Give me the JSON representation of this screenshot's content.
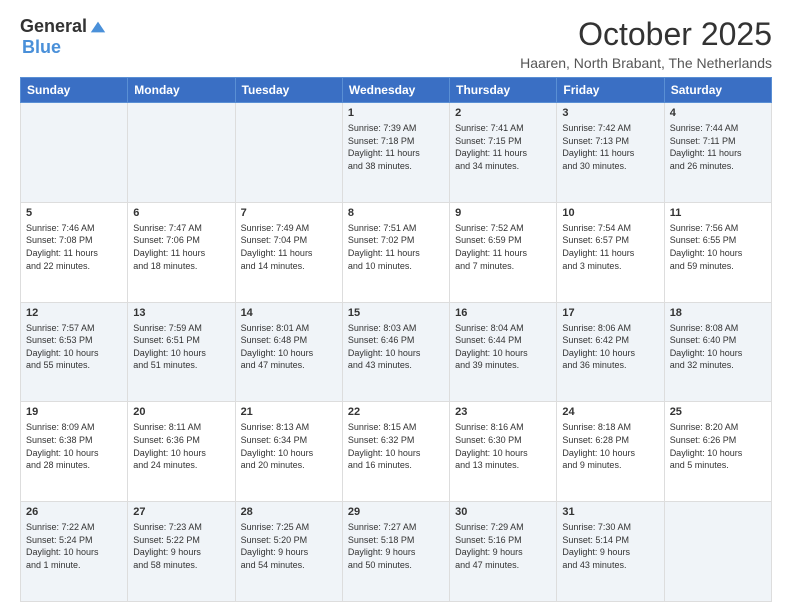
{
  "logo": {
    "general": "General",
    "blue": "Blue"
  },
  "header": {
    "month": "October 2025",
    "location": "Haaren, North Brabant, The Netherlands"
  },
  "days": [
    "Sunday",
    "Monday",
    "Tuesday",
    "Wednesday",
    "Thursday",
    "Friday",
    "Saturday"
  ],
  "weeks": [
    [
      {
        "date": "",
        "info": ""
      },
      {
        "date": "",
        "info": ""
      },
      {
        "date": "",
        "info": ""
      },
      {
        "date": "1",
        "info": "Sunrise: 7:39 AM\nSunset: 7:18 PM\nDaylight: 11 hours\nand 38 minutes."
      },
      {
        "date": "2",
        "info": "Sunrise: 7:41 AM\nSunset: 7:15 PM\nDaylight: 11 hours\nand 34 minutes."
      },
      {
        "date": "3",
        "info": "Sunrise: 7:42 AM\nSunset: 7:13 PM\nDaylight: 11 hours\nand 30 minutes."
      },
      {
        "date": "4",
        "info": "Sunrise: 7:44 AM\nSunset: 7:11 PM\nDaylight: 11 hours\nand 26 minutes."
      }
    ],
    [
      {
        "date": "5",
        "info": "Sunrise: 7:46 AM\nSunset: 7:08 PM\nDaylight: 11 hours\nand 22 minutes."
      },
      {
        "date": "6",
        "info": "Sunrise: 7:47 AM\nSunset: 7:06 PM\nDaylight: 11 hours\nand 18 minutes."
      },
      {
        "date": "7",
        "info": "Sunrise: 7:49 AM\nSunset: 7:04 PM\nDaylight: 11 hours\nand 14 minutes."
      },
      {
        "date": "8",
        "info": "Sunrise: 7:51 AM\nSunset: 7:02 PM\nDaylight: 11 hours\nand 10 minutes."
      },
      {
        "date": "9",
        "info": "Sunrise: 7:52 AM\nSunset: 6:59 PM\nDaylight: 11 hours\nand 7 minutes."
      },
      {
        "date": "10",
        "info": "Sunrise: 7:54 AM\nSunset: 6:57 PM\nDaylight: 11 hours\nand 3 minutes."
      },
      {
        "date": "11",
        "info": "Sunrise: 7:56 AM\nSunset: 6:55 PM\nDaylight: 10 hours\nand 59 minutes."
      }
    ],
    [
      {
        "date": "12",
        "info": "Sunrise: 7:57 AM\nSunset: 6:53 PM\nDaylight: 10 hours\nand 55 minutes."
      },
      {
        "date": "13",
        "info": "Sunrise: 7:59 AM\nSunset: 6:51 PM\nDaylight: 10 hours\nand 51 minutes."
      },
      {
        "date": "14",
        "info": "Sunrise: 8:01 AM\nSunset: 6:48 PM\nDaylight: 10 hours\nand 47 minutes."
      },
      {
        "date": "15",
        "info": "Sunrise: 8:03 AM\nSunset: 6:46 PM\nDaylight: 10 hours\nand 43 minutes."
      },
      {
        "date": "16",
        "info": "Sunrise: 8:04 AM\nSunset: 6:44 PM\nDaylight: 10 hours\nand 39 minutes."
      },
      {
        "date": "17",
        "info": "Sunrise: 8:06 AM\nSunset: 6:42 PM\nDaylight: 10 hours\nand 36 minutes."
      },
      {
        "date": "18",
        "info": "Sunrise: 8:08 AM\nSunset: 6:40 PM\nDaylight: 10 hours\nand 32 minutes."
      }
    ],
    [
      {
        "date": "19",
        "info": "Sunrise: 8:09 AM\nSunset: 6:38 PM\nDaylight: 10 hours\nand 28 minutes."
      },
      {
        "date": "20",
        "info": "Sunrise: 8:11 AM\nSunset: 6:36 PM\nDaylight: 10 hours\nand 24 minutes."
      },
      {
        "date": "21",
        "info": "Sunrise: 8:13 AM\nSunset: 6:34 PM\nDaylight: 10 hours\nand 20 minutes."
      },
      {
        "date": "22",
        "info": "Sunrise: 8:15 AM\nSunset: 6:32 PM\nDaylight: 10 hours\nand 16 minutes."
      },
      {
        "date": "23",
        "info": "Sunrise: 8:16 AM\nSunset: 6:30 PM\nDaylight: 10 hours\nand 13 minutes."
      },
      {
        "date": "24",
        "info": "Sunrise: 8:18 AM\nSunset: 6:28 PM\nDaylight: 10 hours\nand 9 minutes."
      },
      {
        "date": "25",
        "info": "Sunrise: 8:20 AM\nSunset: 6:26 PM\nDaylight: 10 hours\nand 5 minutes."
      }
    ],
    [
      {
        "date": "26",
        "info": "Sunrise: 7:22 AM\nSunset: 5:24 PM\nDaylight: 10 hours\nand 1 minute."
      },
      {
        "date": "27",
        "info": "Sunrise: 7:23 AM\nSunset: 5:22 PM\nDaylight: 9 hours\nand 58 minutes."
      },
      {
        "date": "28",
        "info": "Sunrise: 7:25 AM\nSunset: 5:20 PM\nDaylight: 9 hours\nand 54 minutes."
      },
      {
        "date": "29",
        "info": "Sunrise: 7:27 AM\nSunset: 5:18 PM\nDaylight: 9 hours\nand 50 minutes."
      },
      {
        "date": "30",
        "info": "Sunrise: 7:29 AM\nSunset: 5:16 PM\nDaylight: 9 hours\nand 47 minutes."
      },
      {
        "date": "31",
        "info": "Sunrise: 7:30 AM\nSunset: 5:14 PM\nDaylight: 9 hours\nand 43 minutes."
      },
      {
        "date": "",
        "info": ""
      }
    ]
  ]
}
